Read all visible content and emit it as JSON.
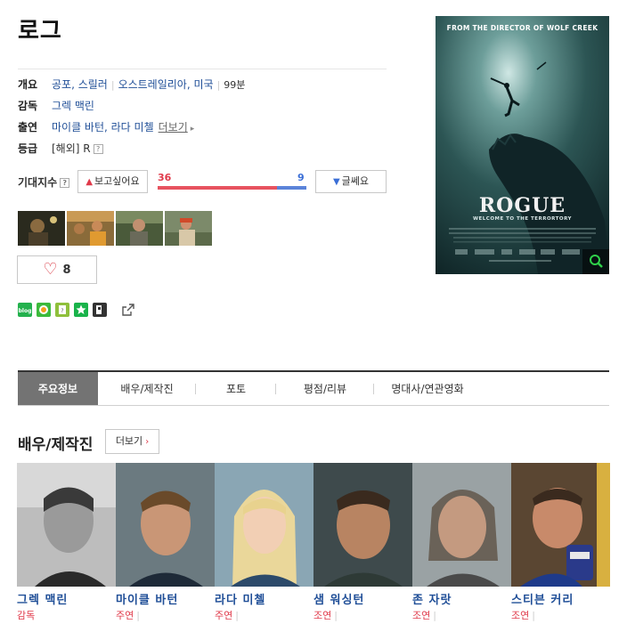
{
  "title": "로그",
  "overview": {
    "label": "개요",
    "genre": "공포, 스릴러",
    "country": "오스트레일리아, 미국",
    "runtime": "99분"
  },
  "director": {
    "label": "감독",
    "name": "그렉 맥린"
  },
  "cast_row": {
    "label": "출연",
    "names": "마이클 바턴, 라다 미첼",
    "more": "더보기"
  },
  "rating": {
    "label": "등급",
    "value": "[해외] R"
  },
  "expectation": {
    "label": "기대지수",
    "want_label": "보고싶어요",
    "meh_label": "글쎄요",
    "want_count": "36",
    "meh_count": "9",
    "want_fraction": 0.8
  },
  "like": {
    "count": "8"
  },
  "share": {
    "icons": [
      "blog-icon",
      "me2day-icon",
      "yozm-icon",
      "star-icon",
      "pinterest-icon"
    ],
    "export_icon": "share-out-icon"
  },
  "poster": {
    "top_text": "FROM THE DIRECTOR OF WOLF CREEK",
    "title": "ROGUE",
    "tagline": "WELCOME TO THE TERRORTORY",
    "zoom_icon": "search-icon"
  },
  "tabs": [
    {
      "label": "주요정보",
      "active": true
    },
    {
      "label": "배우/제작진",
      "active": false
    },
    {
      "label": "포토",
      "active": false
    },
    {
      "label": "평점/리뷰",
      "active": false
    },
    {
      "label": "명대사/연관영화",
      "active": false
    }
  ],
  "section": {
    "title": "배우/제작진",
    "more": "더보기"
  },
  "people": [
    {
      "name": "그렉 맥린",
      "role": "감독"
    },
    {
      "name": "마이클 바턴",
      "role": "주연"
    },
    {
      "name": "라다 미첼",
      "role": "주연"
    },
    {
      "name": "샘 워싱턴",
      "role": "조연"
    },
    {
      "name": "존 자랏",
      "role": "조연"
    },
    {
      "name": "스티븐 커리",
      "role": "조연"
    }
  ],
  "colors": {
    "accent_red": "#e0394a",
    "accent_blue": "#3a6ed6",
    "link_blue": "#1f4e97",
    "active_tab": "#737373"
  }
}
